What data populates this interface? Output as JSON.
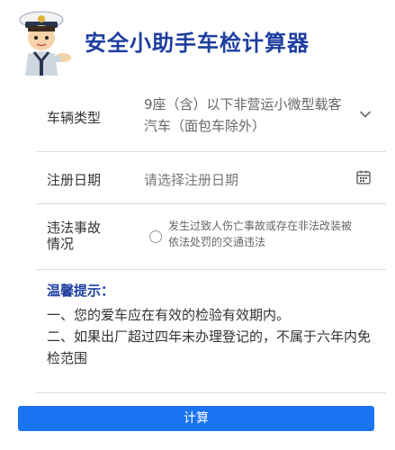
{
  "header": {
    "title": "安全小助手车检计算器",
    "mascot_icon": "traffic-police-mascot"
  },
  "form": {
    "vehicle_type": {
      "label": "车辆类型",
      "value": "9座（含）以下非营运小微型载客汽车（面包车除外）",
      "icon": "chevron-down-icon"
    },
    "registration_date": {
      "label": "注册日期",
      "placeholder": "请选择注册日期",
      "icon": "calendar-icon"
    },
    "violation": {
      "label": "违法事故情况",
      "option_text": "发生过致人伤亡事故或存在非法改装被依法处罚的交通违法",
      "checked": false
    }
  },
  "tips": {
    "title": "温馨提示：",
    "items": [
      "一、您的爱车应在有效的检验有效期内。",
      "二、如果出厂超过四年未办理登记的，不属于六年内免检范围"
    ]
  },
  "submit": {
    "label": "计算"
  },
  "colors": {
    "title_blue": "#1e3fa0",
    "button_blue": "#1a73f0",
    "divider": "#dcdcdc"
  }
}
